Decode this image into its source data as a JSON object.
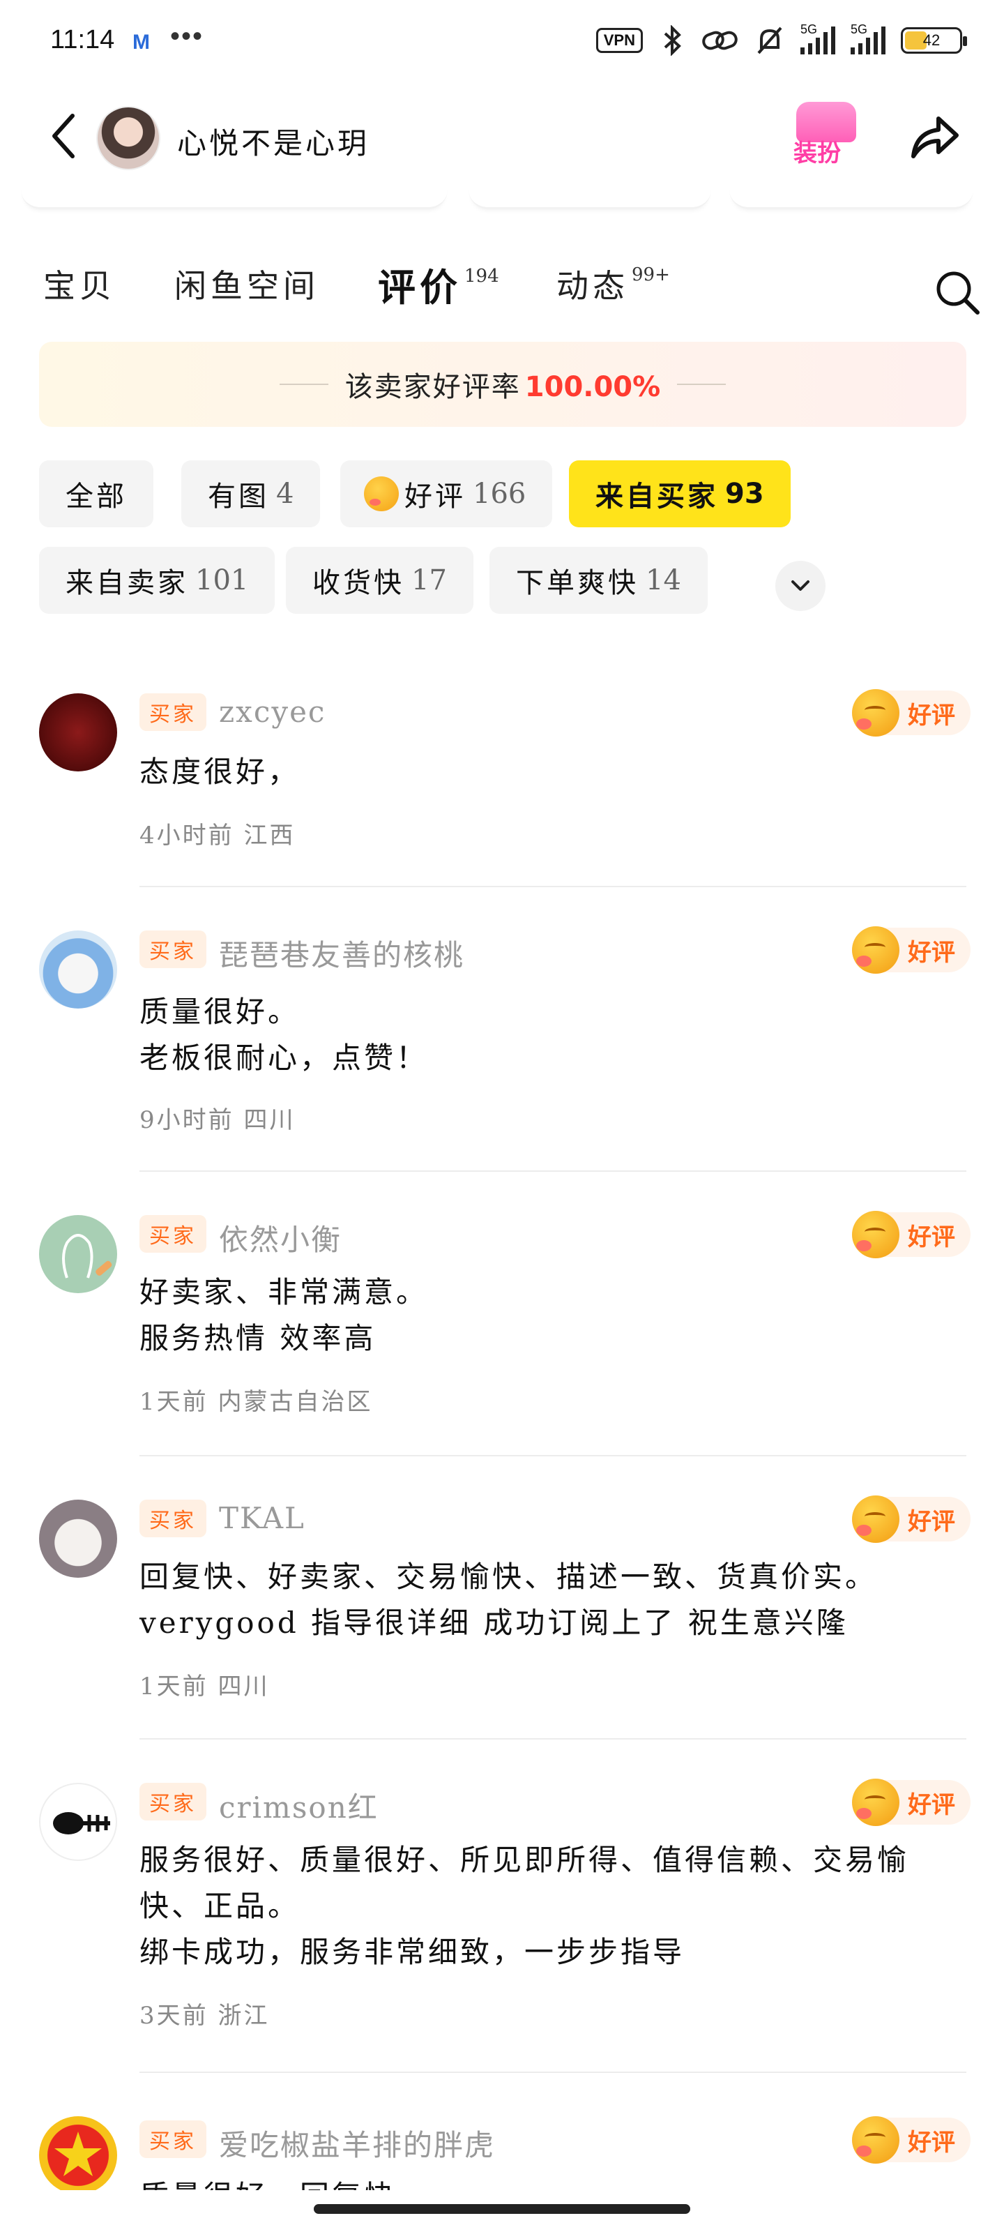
{
  "status": {
    "time": "11:14",
    "vpn": "VPN",
    "net1": "5G",
    "net2": "5G",
    "battery": "42"
  },
  "header": {
    "shop_name": "心悦不是心玥",
    "dress_label": "装扮"
  },
  "tabs": [
    {
      "label": "宝贝",
      "count": ""
    },
    {
      "label": "闲鱼空间",
      "count": ""
    },
    {
      "label": "评价",
      "count": "194"
    },
    {
      "label": "动态",
      "count": "99+"
    }
  ],
  "banner": {
    "text": "该卖家好评率",
    "rate": "100.00%"
  },
  "filters": [
    {
      "label": "全部",
      "count": ""
    },
    {
      "label": "有图",
      "count": "4"
    },
    {
      "label": "好评",
      "count": "166"
    },
    {
      "label": "来自买家",
      "count": "93"
    },
    {
      "label": "来自卖家",
      "count": "101"
    },
    {
      "label": "收货快",
      "count": "17"
    },
    {
      "label": "下单爽快",
      "count": "14"
    }
  ],
  "reviews": [
    {
      "tag": "买家",
      "name": "zxcyec",
      "badge": "好评",
      "lines": [
        "态度很好，"
      ],
      "meta": "4小时前 江西"
    },
    {
      "tag": "买家",
      "name": "琵琶巷友善的核桃",
      "badge": "好评",
      "lines": [
        "质量很好。",
        "老板很耐心，点赞！"
      ],
      "meta": "9小时前 四川"
    },
    {
      "tag": "买家",
      "name": "依然小衡",
      "badge": "好评",
      "lines": [
        "好卖家、非常满意。",
        "服务热情 效率高"
      ],
      "meta": "1天前 内蒙古自治区"
    },
    {
      "tag": "买家",
      "name": "TKAL",
      "badge": "好评",
      "lines": [
        "回复快、好卖家、交易愉快、描述一致、货真价实。",
        "verygood 指导很详细 成功订阅上了 祝生意兴隆"
      ],
      "meta": "1天前 四川"
    },
    {
      "tag": "买家",
      "name": "crimson红",
      "badge": "好评",
      "lines": [
        "服务很好、质量很好、所见即所得、值得信赖、交易愉",
        "快、正品。",
        "绑卡成功，服务非常细致，一步步指导"
      ],
      "meta": "3天前 浙江"
    },
    {
      "tag": "买家",
      "name": "爱吃椒盐羊排的胖虎",
      "badge": "好评",
      "lines": [
        "质量很好、回复快"
      ],
      "meta": ""
    }
  ],
  "colors": {
    "accent_yellow": "#ffe31a",
    "rate_red": "#ff3b30",
    "tag_orange": "#ff6a1a"
  }
}
